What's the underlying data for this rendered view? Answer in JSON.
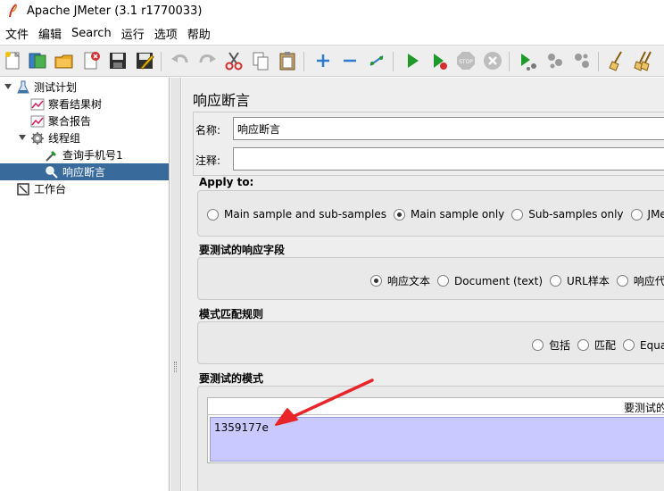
{
  "window": {
    "title": "Apache JMeter (3.1 r1770033)"
  },
  "menu": [
    "文件",
    "编辑",
    "Search",
    "运行",
    "选项",
    "帮助"
  ],
  "toolbar_icons": [
    "new-icon",
    "templates-icon",
    "open-icon",
    "close-icon",
    "save-icon",
    "save-as-icon",
    "undo-icon",
    "redo-icon",
    "cut-icon",
    "copy-icon",
    "paste-icon",
    "expand-icon",
    "collapse-icon",
    "toggle-icon",
    "start-icon",
    "start-no-pauses-icon",
    "stop-icon",
    "shutdown-icon",
    "remote-start-icon",
    "remote-stop-icon",
    "remote-shutdown-icon",
    "clear-icon",
    "clear-all-icon"
  ],
  "tree": {
    "test_plan": "测试计划",
    "view_results_tree": "察看结果树",
    "aggregate_report": "聚合报告",
    "thread_group": "线程组",
    "http_request": "查询手机号1",
    "response_assertion": "响应断言",
    "workbench": "工作台"
  },
  "panel": {
    "title": "响应断言",
    "name_label": "名称:",
    "name_value": "响应断言",
    "comment_label": "注释:",
    "comment_value": "",
    "apply_to": {
      "title": "Apply to:",
      "options": [
        "Main sample and sub-samples",
        "Main sample only",
        "Sub-samples only",
        "JMeter V"
      ],
      "selected": 1
    },
    "response_field": {
      "title": "要测试的响应字段",
      "options": [
        "响应文本",
        "Document (text)",
        "URL样本",
        "响应代码"
      ],
      "selected": 0
    },
    "pattern_rules": {
      "title": "模式匹配规则",
      "options": [
        "包括",
        "匹配",
        "Equa"
      ],
      "selected": -1
    },
    "patterns": {
      "title": "要测试的模式",
      "column_header": "要测试的模式",
      "rows": [
        "1359177e"
      ]
    }
  },
  "colors": {
    "selection": "#386b9c",
    "pattern_row": "#c9c9ff",
    "arrow": "#e8262a",
    "run_green": "#1f9a2a"
  }
}
